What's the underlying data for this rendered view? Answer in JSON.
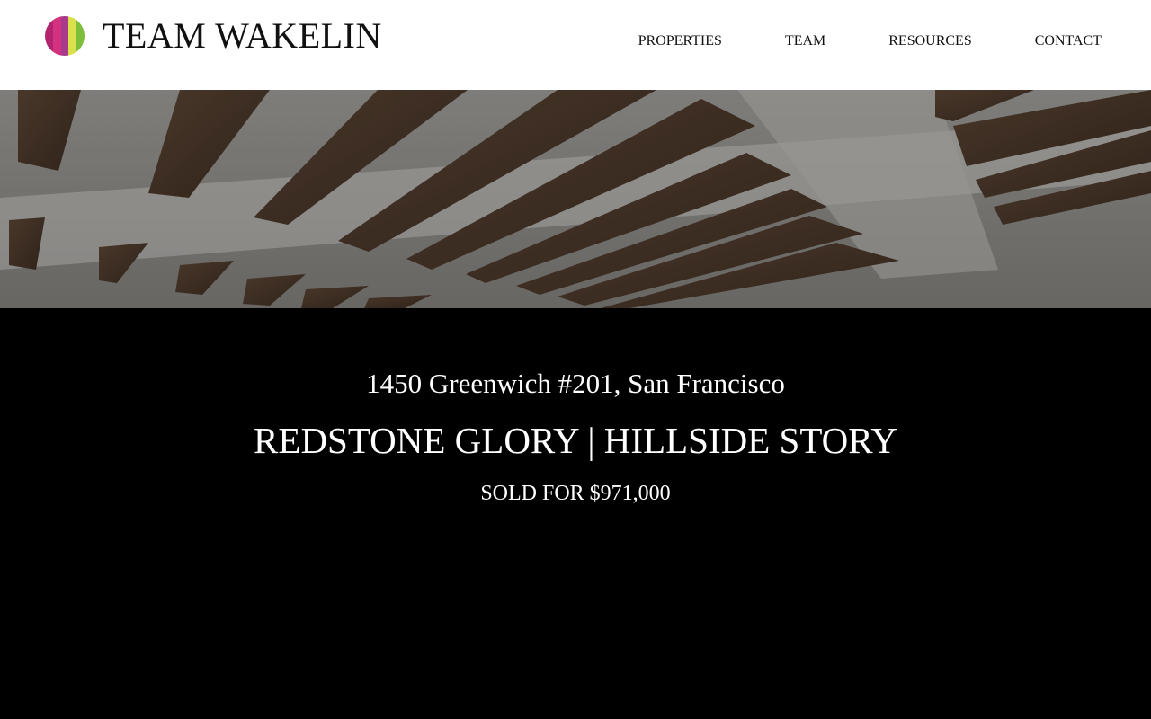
{
  "brand": {
    "name": "TEAM WAKELIN",
    "logo_colors": [
      "#b3236f",
      "#d4327f",
      "#a73a8c",
      "#d9e04a",
      "#7dbf3c"
    ]
  },
  "nav": {
    "items": [
      "PROPERTIES",
      "TEAM",
      "RESOURCES",
      "CONTACT"
    ]
  },
  "hero": {
    "image": "interior ceiling with dark wooden beams"
  },
  "listing": {
    "address": "1450 Greenwich #201, San Francisco",
    "headline": "REDSTONE GLORY | HILLSIDE STORY",
    "status": "SOLD FOR $971,000"
  },
  "colors": {
    "header_bg": "#ffffff",
    "content_bg": "#000000",
    "text_light": "#ffffff",
    "text_dark": "#111111"
  }
}
